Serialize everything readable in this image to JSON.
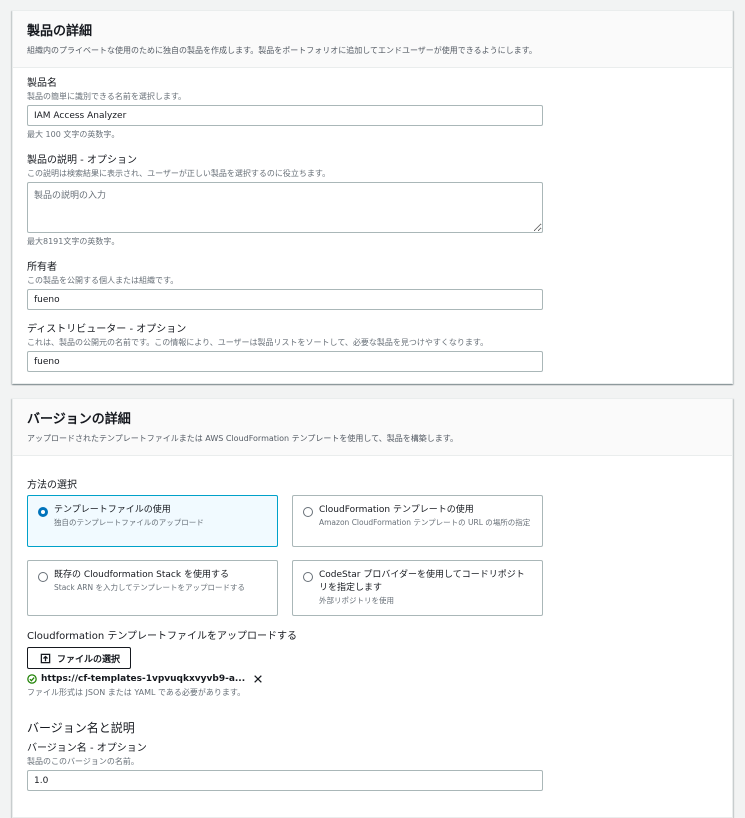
{
  "product_details": {
    "title": "製品の詳細",
    "description": "組織内のプライベートな使用のために独自の製品を作成します。製品をポートフォリオに追加してエンドユーザーが使用できるようにします。",
    "name": {
      "label": "製品名",
      "description": "製品の簡単に識別できる名前を選択します。",
      "value": "IAM Access Analyzer",
      "constraint": "最大 100 文字の英数字。"
    },
    "product_description": {
      "label": "製品の説明 - オプション",
      "description": "この説明は検索結果に表示され、ユーザーが正しい製品を選択するのに役立ちます。",
      "placeholder": "製品の説明の入力",
      "constraint": "最大8191文字の英数字。"
    },
    "owner": {
      "label": "所有者",
      "description": "この製品を公開する個人または組織です。",
      "value": "fueno"
    },
    "distributor": {
      "label": "ディストリビューター - オプション",
      "description": "これは、製品の公開元の名前です。この情報により、ユーザーは製品リストをソートして、必要な製品を見つけやすくなります。",
      "value": "fueno"
    }
  },
  "version_details": {
    "title": "バージョンの詳細",
    "description": "アップロードされたテンプレートファイルまたは AWS CloudFormation テンプレートを使用して、製品を構築します。",
    "method_label": "方法の選択",
    "methods": [
      {
        "title": "テンプレートファイルの使用",
        "description": "独自のテンプレートファイルのアップロード",
        "selected": true
      },
      {
        "title": "CloudFormation テンプレートの使用",
        "description": "Amazon CloudFormation テンプレートの URL の場所の指定",
        "selected": false
      },
      {
        "title": "既存の Cloudformation Stack を使用する",
        "description": "Stack ARN を入力してテンプレートをアップロードする",
        "selected": false
      },
      {
        "title": "CodeStar プロバイダーを使用してコードリポジトリを指定します",
        "description": "外部リポジトリを使用",
        "selected": false
      }
    ],
    "upload": {
      "label": "Cloudformation テンプレートファイルをアップロードする",
      "button_label": "ファイルの選択",
      "file_name": "https://cf-templates-1vpvuqkxvyvb9-a...",
      "constraint": "ファイル形式は JSON または YAML である必要があります。"
    },
    "version_section_title": "バージョン名と説明",
    "version_name": {
      "label": "バージョン名 - オプション",
      "description": "製品のこのバージョンの名前。",
      "value": "1.0"
    }
  },
  "colors": {
    "accent": "#0073bb",
    "selected_border": "#00a1c9",
    "success": "#1d8102"
  }
}
